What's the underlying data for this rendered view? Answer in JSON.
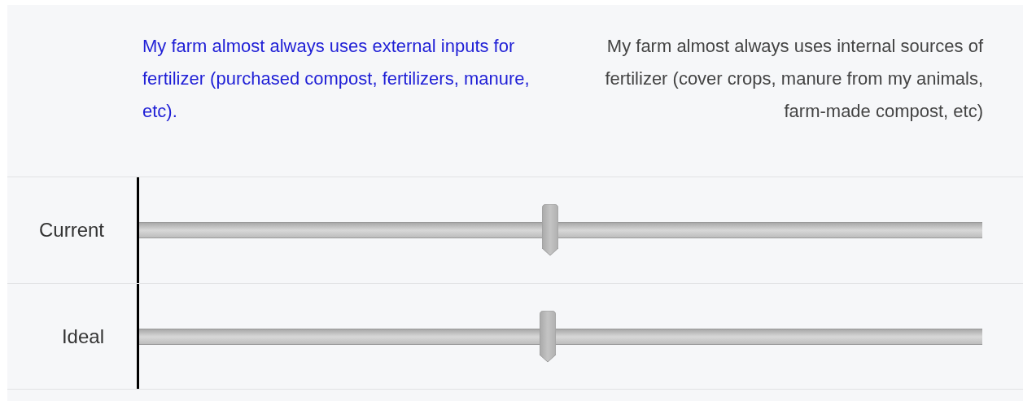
{
  "anchors": {
    "left": "My farm almost always uses external inputs for fertilizer (purchased compost, fertilizers, manure, etc).",
    "right": "My farm almost always uses internal sources of fertilizer (cover crops, manure from my animals, farm-made compost, etc)"
  },
  "rows": [
    {
      "label": "Current",
      "level": 0.487
    },
    {
      "label": "Ideal",
      "level": 0.485
    }
  ]
}
